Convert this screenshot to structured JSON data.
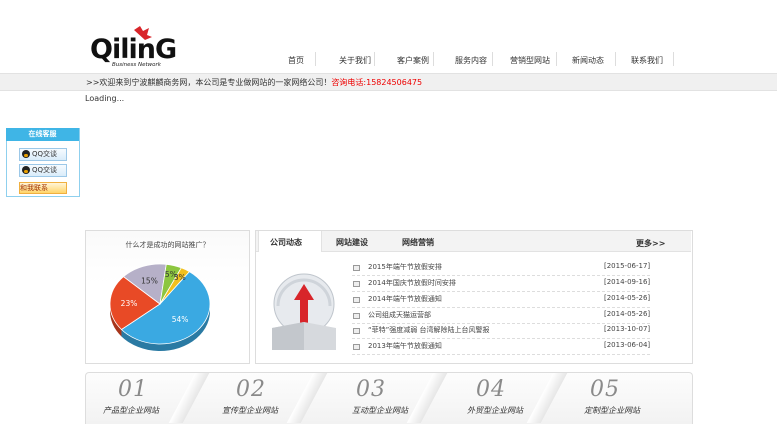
{
  "header": {
    "logo": {
      "text": "QilinG",
      "tagline": "Business Network"
    },
    "nav": [
      "首页",
      "关于我们",
      "客户案例",
      "服务内容",
      "营销型网站",
      "新闻动态",
      "联系我们"
    ]
  },
  "welcome": {
    "text": ">>欢迎来到宁波麒麟商务网，本公司是专业做网站的一家网络公司！",
    "phone": "咨询电话:15824506475"
  },
  "loading": "Loading...",
  "online_service": {
    "title": "在线客服",
    "qq1": "QQ交谈",
    "qq2": "QQ交谈",
    "message": "和我联系"
  },
  "pie_panel": {
    "title": "什么才是成功的网站推广？",
    "chart_data": {
      "type": "pie",
      "title": "什么才是成功的网站推广？",
      "slices": [
        {
          "label": "54%",
          "value": 54,
          "color": "#3aa9e2"
        },
        {
          "label": "23%",
          "value": 23,
          "color": "#e84a26"
        },
        {
          "label": "15%",
          "value": 15,
          "color": "#b6b0c8"
        },
        {
          "label": "5%",
          "value": 5,
          "color": "#8cc63f"
        },
        {
          "label": "3%",
          "value": 3,
          "color": "#f2c01e"
        }
      ]
    }
  },
  "news": {
    "tabs": [
      "公司动态",
      "网站建设",
      "网络营销"
    ],
    "more": "更多>>",
    "items": [
      {
        "title": "2015年端午节放假安排",
        "date": "[2015-06-17]"
      },
      {
        "title": "2014年国庆节放假时间安排",
        "date": "[2014-09-16]"
      },
      {
        "title": "2014年端午节放假通知",
        "date": "[2014-05-26]"
      },
      {
        "title": "公司组成天猫运营部",
        "date": "[2014-05-26]"
      },
      {
        "title": "“菲特”强度减弱 台湾解除陆上台风警报",
        "date": "[2013-10-07]"
      },
      {
        "title": "2013年端午节放假通知",
        "date": "[2013-06-04]"
      }
    ]
  },
  "services": [
    {
      "num": "01",
      "label": "产品型企业网站"
    },
    {
      "num": "02",
      "label": "宣传型企业网站"
    },
    {
      "num": "03",
      "label": "互动型企业网站"
    },
    {
      "num": "04",
      "label": "外贸型企业网站"
    },
    {
      "num": "05",
      "label": "定制型企业网站"
    }
  ]
}
